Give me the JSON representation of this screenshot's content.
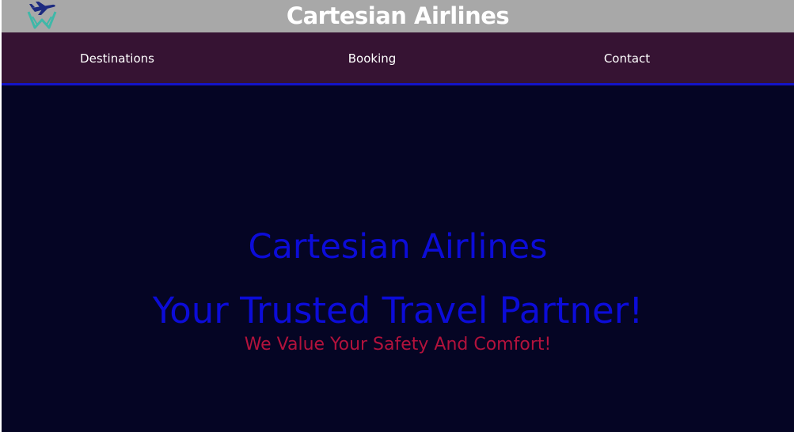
{
  "header": {
    "title": "Cartesian Airlines",
    "logo_icon": "airplane-logo-icon",
    "bg_color": "#a8a8a8"
  },
  "nav": {
    "items": [
      {
        "label": "Destinations"
      },
      {
        "label": "Booking"
      },
      {
        "label": "Contact"
      }
    ],
    "bg_color": "#361333",
    "border_color": "#1414c8"
  },
  "hero": {
    "title": "Cartesian Airlines",
    "tagline": "Your Trusted Travel Partner!",
    "subtitle": "We Value Your Safety And Comfort!",
    "bg_color": "#050524",
    "title_color": "#0c0cd8",
    "subtitle_color": "#b3123c"
  }
}
